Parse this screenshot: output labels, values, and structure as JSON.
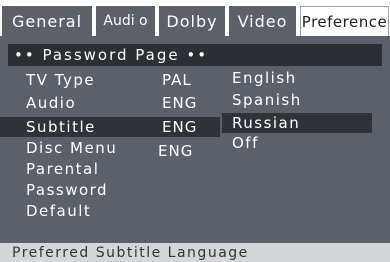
{
  "tabs": [
    {
      "label": "General"
    },
    {
      "label": "Audi o"
    },
    {
      "label": "Dolby"
    },
    {
      "label": "Video"
    },
    {
      "label": "Preference"
    }
  ],
  "page_header": "•• Password Page ••",
  "settings": [
    {
      "label": "TV Type",
      "value": "PAL"
    },
    {
      "label": "Audio",
      "value": "ENG"
    },
    {
      "label": "Subtitle",
      "value": "ENG"
    },
    {
      "label": "Disc Menu",
      "value": "ENG"
    },
    {
      "label": "Parental",
      "value": ""
    },
    {
      "label": "Password",
      "value": ""
    },
    {
      "label": "Default",
      "value": ""
    }
  ],
  "options": [
    {
      "label": "English"
    },
    {
      "label": "Spanish"
    },
    {
      "label": "Russian"
    },
    {
      "label": "Off"
    }
  ],
  "status": "Preferred Subtitle Language",
  "colors": {
    "panel": "#5c6068",
    "header": "#2b2e33",
    "selection": "#2f3237",
    "status_bar": "#d4d6da"
  }
}
